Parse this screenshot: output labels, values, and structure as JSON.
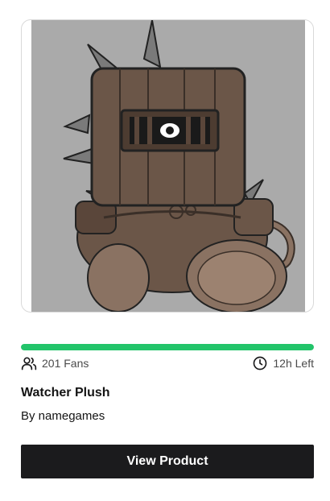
{
  "product": {
    "name": "Watcher Plush",
    "creator": "By namegames",
    "fans_label": "201 Fans",
    "time_left_label": "12h Left",
    "funding_progress": 1.0,
    "cta_label": "View Product"
  },
  "icons": {
    "fans": "users-icon",
    "time": "clock-icon"
  },
  "colors": {
    "progress": "#22c46a",
    "button": "#1b1b1d",
    "image_background": "#aaaaaa"
  }
}
